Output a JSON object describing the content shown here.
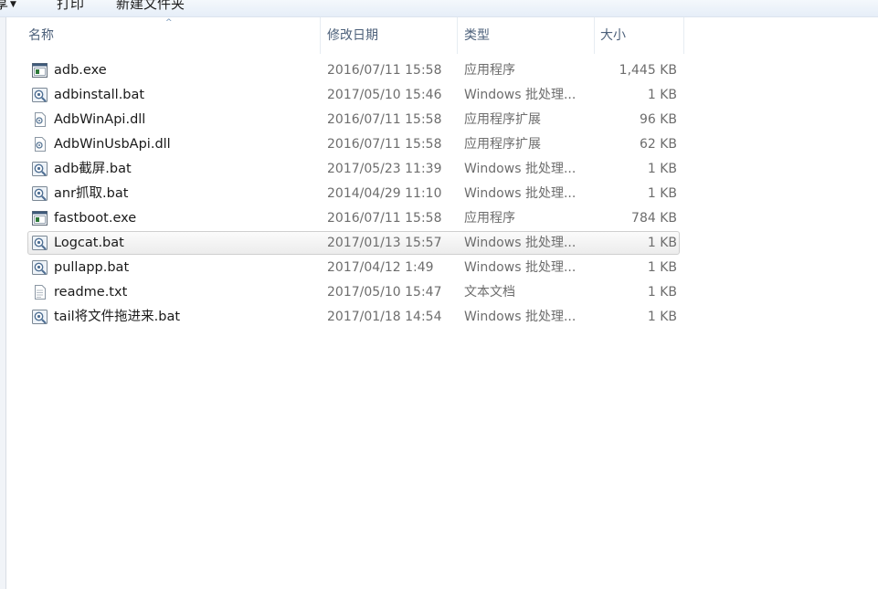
{
  "toolbar": {
    "share_label": "享",
    "print_label": "打印",
    "new_folder_label": "新建文件夹"
  },
  "columns": {
    "name": "名称",
    "date": "修改日期",
    "type": "类型",
    "size": "大小"
  },
  "files": [
    {
      "name": "adb.exe",
      "date": "2016/07/11 15:58",
      "type": "应用程序",
      "size": "1,445 KB",
      "icon": "exe-icon"
    },
    {
      "name": "adbinstall.bat",
      "date": "2017/05/10 15:46",
      "type": "Windows 批处理...",
      "size": "1 KB",
      "icon": "bat-icon"
    },
    {
      "name": "AdbWinApi.dll",
      "date": "2016/07/11 15:58",
      "type": "应用程序扩展",
      "size": "96 KB",
      "icon": "dll-icon"
    },
    {
      "name": "AdbWinUsbApi.dll",
      "date": "2016/07/11 15:58",
      "type": "应用程序扩展",
      "size": "62 KB",
      "icon": "dll-icon"
    },
    {
      "name": "adb截屏.bat",
      "date": "2017/05/23 11:39",
      "type": "Windows 批处理...",
      "size": "1 KB",
      "icon": "bat-icon"
    },
    {
      "name": "anr抓取.bat",
      "date": "2014/04/29 11:10",
      "type": "Windows 批处理...",
      "size": "1 KB",
      "icon": "bat-icon"
    },
    {
      "name": "fastboot.exe",
      "date": "2016/07/11 15:58",
      "type": "应用程序",
      "size": "784 KB",
      "icon": "exe-icon"
    },
    {
      "name": "Logcat.bat",
      "date": "2017/01/13 15:57",
      "type": "Windows 批处理...",
      "size": "1 KB",
      "icon": "bat-icon",
      "selected": true
    },
    {
      "name": "pullapp.bat",
      "date": "2017/04/12 1:49",
      "type": "Windows 批处理...",
      "size": "1 KB",
      "icon": "bat-icon"
    },
    {
      "name": "readme.txt",
      "date": "2017/05/10 15:47",
      "type": "文本文档",
      "size": "1 KB",
      "icon": "txt-icon"
    },
    {
      "name": "tail将文件拖进来.bat",
      "date": "2017/01/18 14:54",
      "type": "Windows 批处理...",
      "size": "1 KB",
      "icon": "bat-icon"
    }
  ]
}
